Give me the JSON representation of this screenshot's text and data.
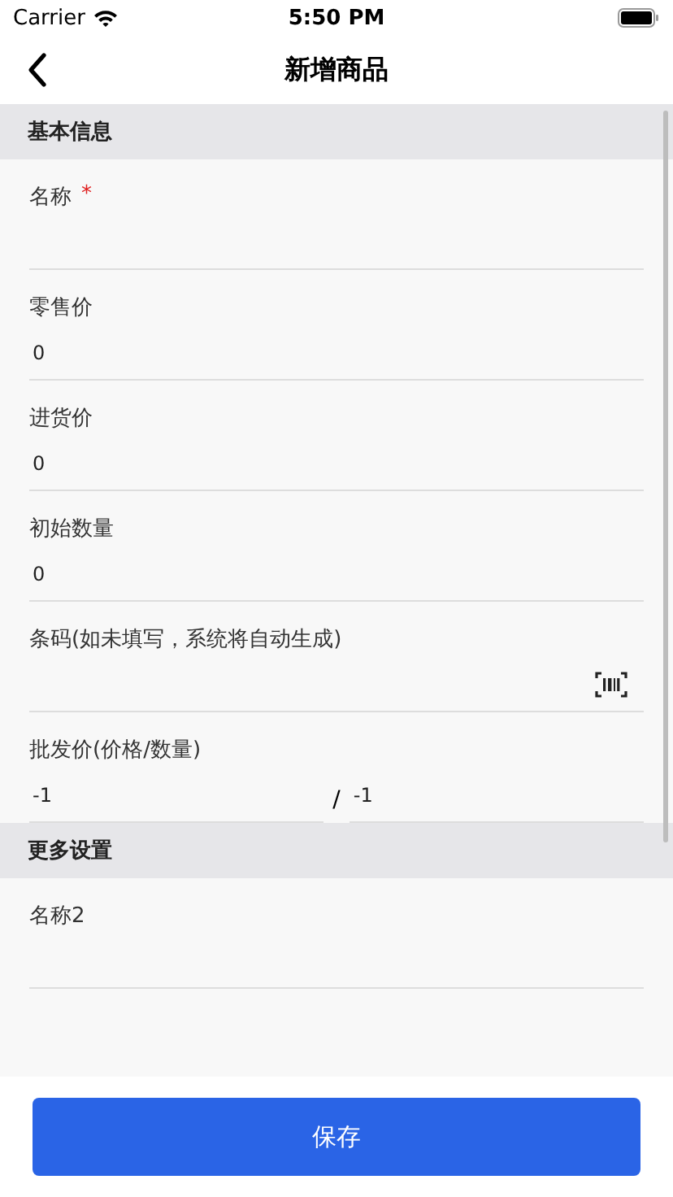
{
  "status_bar": {
    "carrier": "Carrier",
    "time": "5:50 PM"
  },
  "nav": {
    "title": "新增商品"
  },
  "sections": [
    {
      "title": "基本信息",
      "fields": [
        {
          "kind": "text",
          "label": "名称",
          "required_mark": "*"
        },
        {
          "kind": "text",
          "label": "零售价",
          "value": "0"
        },
        {
          "kind": "text",
          "label": "进货价",
          "value": "0"
        },
        {
          "kind": "text",
          "label": "初始数量",
          "value": "0"
        },
        {
          "kind": "barcode",
          "label": "条码(如未填写，系统将自动生成)"
        },
        {
          "kind": "pair",
          "label": "批发价(价格/数量)",
          "value": "-1",
          "separator": "/",
          "value_2": "-1"
        }
      ]
    },
    {
      "title": "更多设置",
      "fields": [
        {
          "kind": "text",
          "label": "名称2"
        }
      ]
    }
  ],
  "save_button": "保存"
}
